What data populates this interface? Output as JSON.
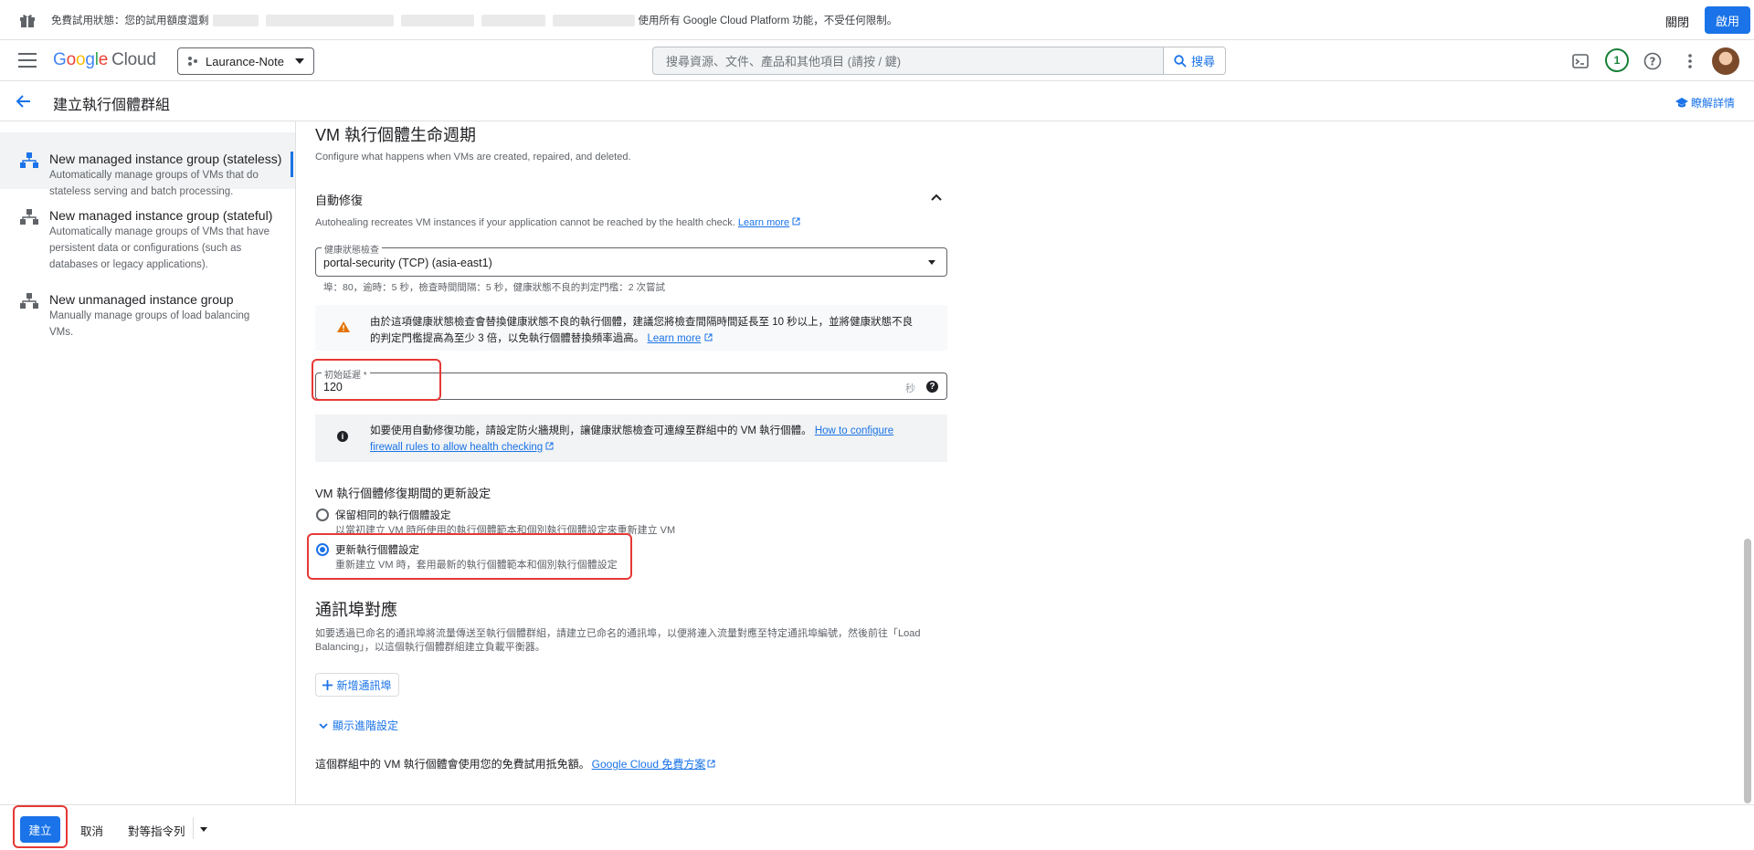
{
  "banner": {
    "message_prefix": "免費試用狀態：您的試用額度還剩",
    "message_suffix": "使用所有 Google Cloud Platform 功能，不受任何限制。",
    "dismiss_label": "關閉",
    "activate_label": "啟用"
  },
  "header": {
    "logo_google": [
      "G",
      "o",
      "o",
      "g",
      "l",
      "e"
    ],
    "logo_cloud": "Cloud",
    "project_name": "Laurance-Note",
    "search_placeholder": "搜尋資源、文件、產品和其他項目 (請按 / 鍵)",
    "search_button": "搜尋",
    "notification_count": "1"
  },
  "title_bar": {
    "title": "建立執行個體群組",
    "learn_more": "瞭解詳情"
  },
  "sidebar": {
    "items": [
      {
        "title": "New managed instance group (stateless)",
        "desc_line1": "Automatically manage groups of VMs that do",
        "desc_line2": "stateless serving and batch processing."
      },
      {
        "title": "New managed instance group (stateful)",
        "desc_line1": "Automatically manage groups of VMs that have",
        "desc_line2": "persistent data or configurations (such as",
        "desc_line3": "databases or legacy applications)."
      },
      {
        "title": "New unmanaged instance group",
        "desc_line1": "Manually manage groups of load balancing",
        "desc_line2": "VMs."
      }
    ]
  },
  "lifecycle": {
    "heading": "VM 執行個體生命週期",
    "description": "Configure what happens when VMs are created, repaired, and deleted."
  },
  "autohealing": {
    "heading": "自動修復",
    "description": "Autohealing recreates VM instances if your application cannot be reached by the health check.",
    "learn_more": "Learn more",
    "health_check_label": "健康狀態檢查",
    "health_check_value": "portal-security (TCP) (asia-east1)",
    "health_check_details": "埠：80，逾時：5 秒，檢查時間間隔：5 秒，健康狀態不良的判定門檻：2 次嘗試",
    "warning_line1": "由於這項健康狀態檢查會替換健康狀態不良的執行個體，建議您將檢查間隔時間延長至 10 秒以上，並將健康狀態不良",
    "warning_line2": "的判定門檻提高為至少 3 倍，以免執行個體替換頻率過高。",
    "warning_learn_more": "Learn more",
    "initial_delay_label": "初始延遲 *",
    "initial_delay_value": "120",
    "initial_delay_unit": "秒",
    "info_line1": "如要使用自動修復功能，請設定防火牆規則，讓健康狀態檢查可連線至群組中的 VM 執行個體。",
    "info_link1": "How to configure",
    "info_link2": "firewall rules to allow health checking"
  },
  "update_config": {
    "heading": "VM 執行個體修復期間的更新設定",
    "options": [
      {
        "label": "保留相同的執行個體設定",
        "desc": "以當初建立 VM 時所使用的執行個體範本和個別執行個體設定來重新建立 VM",
        "checked": false
      },
      {
        "label": "更新執行個體設定",
        "desc": "重新建立 VM 時，套用最新的執行個體範本和個別執行個體設定",
        "checked": true
      }
    ]
  },
  "port_mapping": {
    "heading": "通訊埠對應",
    "desc_line1": "如要透過已命名的通訊埠將流量傳送至執行個體群組，請建立已命名的通訊埠，以便將連入流量對應至特定通訊埠編號，然後前往「Load",
    "desc_line2": "Balancing」，以這個執行個體群組建立負載平衡器。",
    "add_port_label": "新增通訊埠",
    "advanced_label": "顯示進階設定"
  },
  "footer_note": {
    "text": "這個群組中的 VM 執行個體會使用您的免費試用抵免額。",
    "link": "Google Cloud 免費方案"
  },
  "bottom_bar": {
    "create_label": "建立",
    "cancel_label": "取消",
    "equivalent_label": "對等指令列"
  },
  "icons": {
    "gift": "gift-icon",
    "menu": "hamburger-menu-icon",
    "terminal": "cloud-shell-icon",
    "help": "help-icon",
    "more": "more-vert-icon",
    "back": "arrow-back-icon",
    "school": "school-icon"
  },
  "colors": {
    "accent": "#1a73e8",
    "highlight": "#e53935",
    "warning": "#e37400"
  }
}
